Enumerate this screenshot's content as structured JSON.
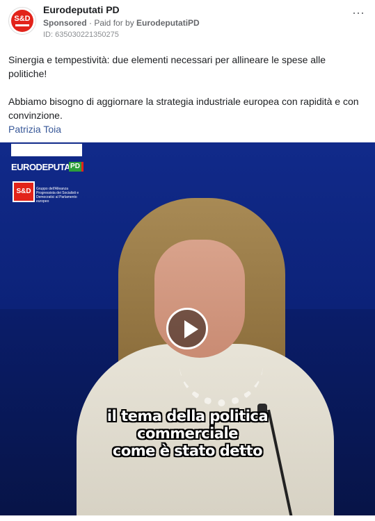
{
  "post": {
    "page_name": "Eurodeputati PD",
    "sponsored": "Sponsored",
    "paid_for_prefix": " · Paid for by ",
    "paid_for_by": "EurodeputatiPD",
    "ad_id": "ID: 635030221350275",
    "body_paragraph_1": "Sinergia e tempestività: due elementi necessari per allineare le spese alle politiche!",
    "body_paragraph_2": "Abbiamo bisogno di aggiornare la strategia industriale europea con rapidità e con convinzione.",
    "author": "Patrizia Toia",
    "more_icon": "more-horizontal-icon",
    "more_glyph": "···"
  },
  "avatar": {
    "label": "S&D"
  },
  "video": {
    "logo_text": "EURODEPUTATI",
    "logo_badge": "PD",
    "sd_label": "S&D",
    "sd_caption": "Gruppo dell'Alleanza Progressista dei Socialisti e Democratici al Parlamento europeo",
    "subtitles": [
      "il tema della politica",
      "commerciale",
      "come è stato detto"
    ],
    "play_icon": "play-icon"
  },
  "colors": {
    "accent_red": "#e2231a",
    "link_blue": "#385898",
    "video_bg": "#0c2278"
  }
}
